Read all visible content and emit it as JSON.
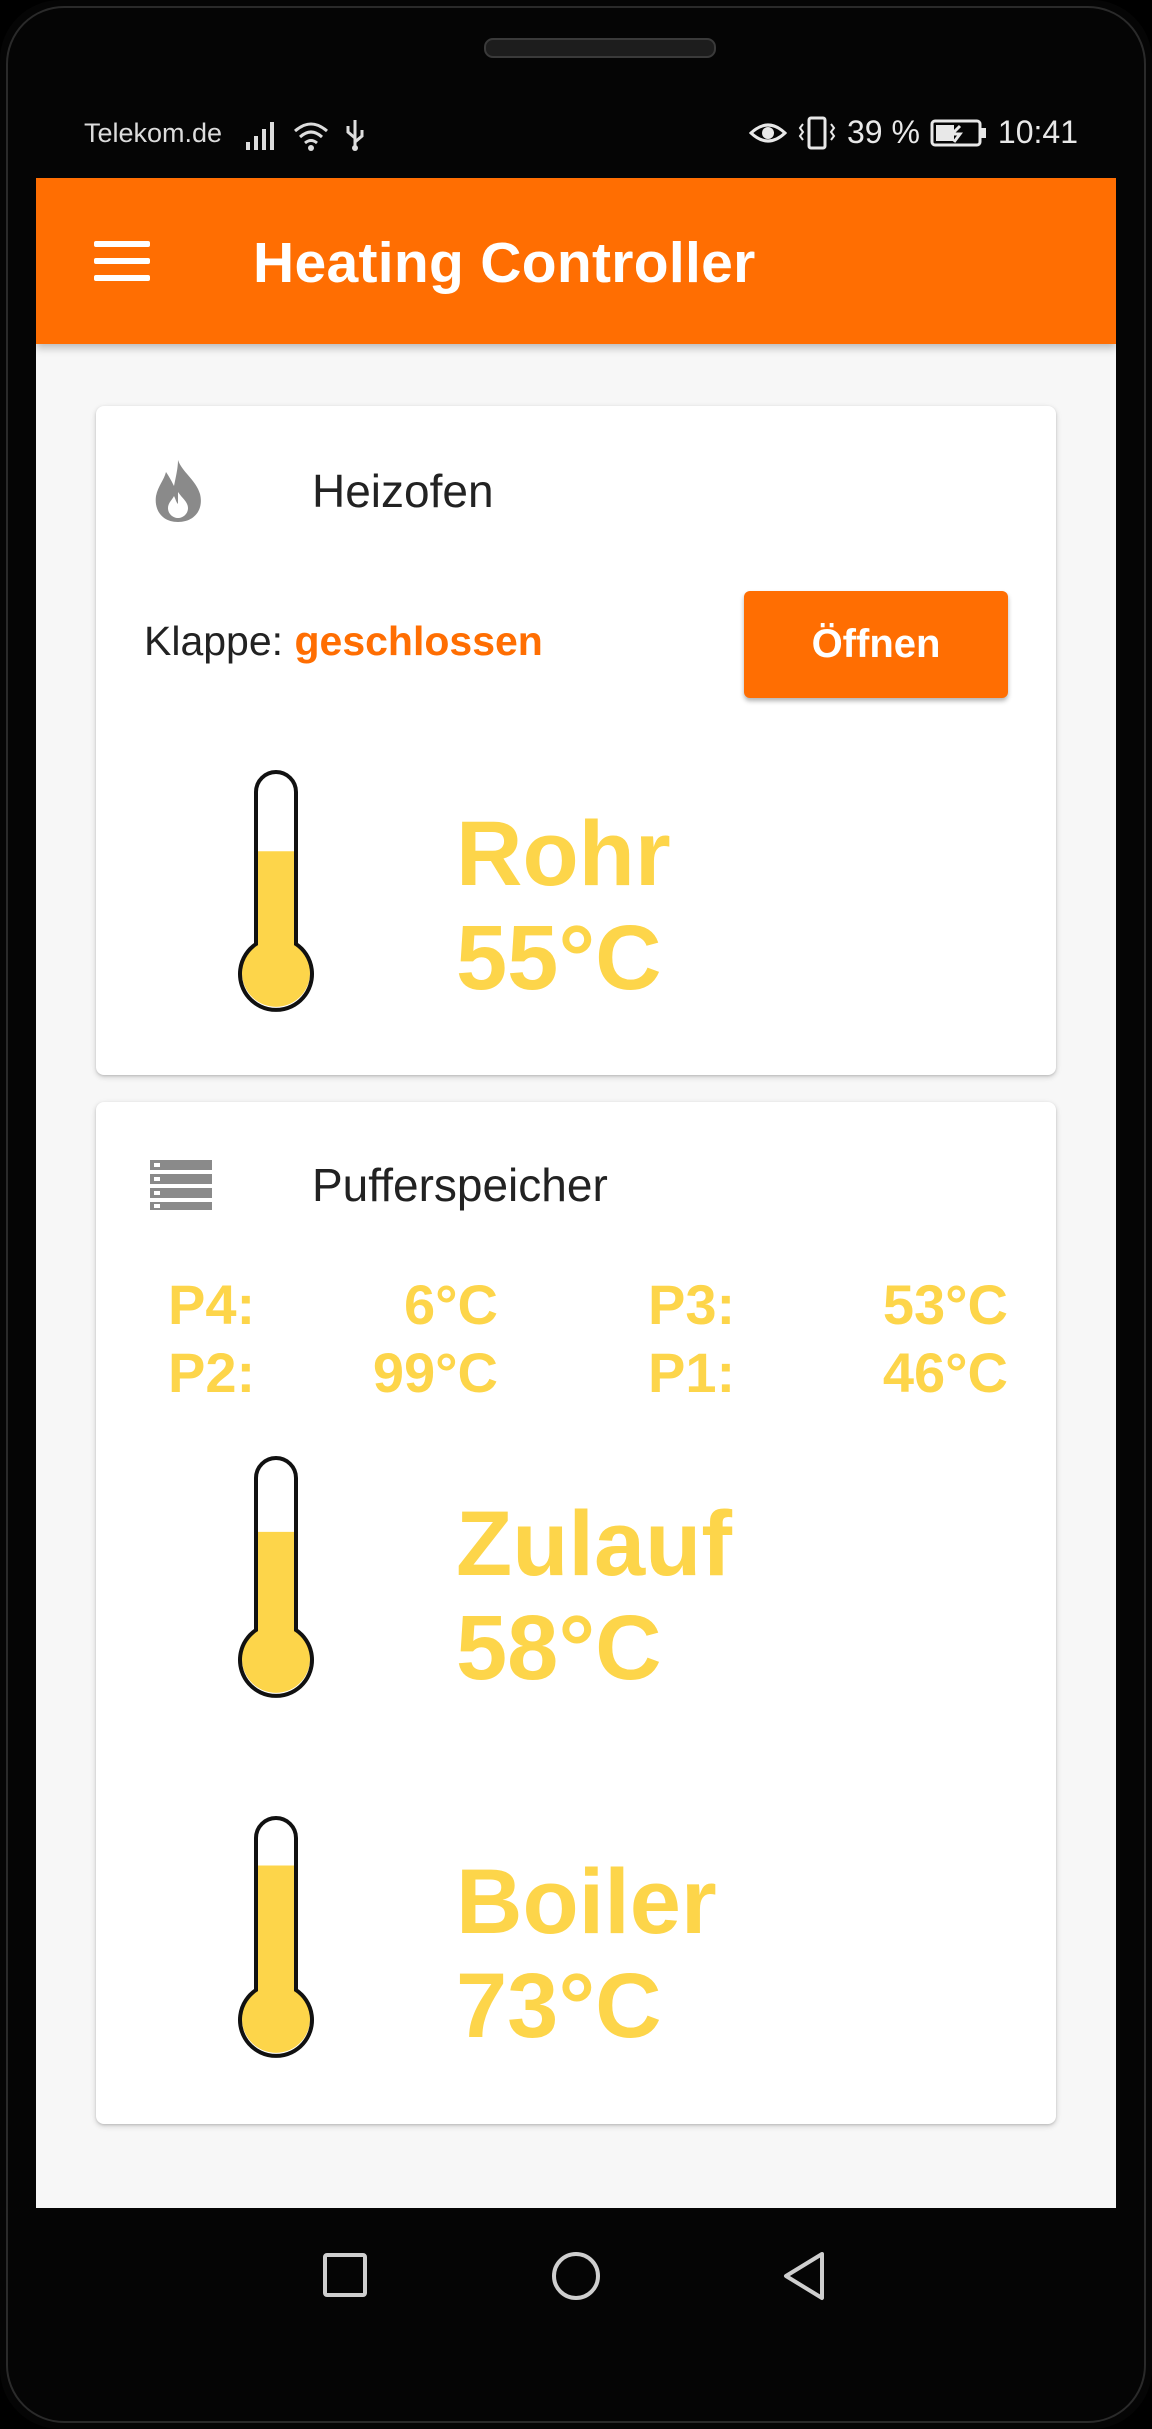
{
  "status_bar": {
    "carrier": "Telekom.de",
    "battery": "39 %",
    "time": "10:41"
  },
  "app": {
    "title": "Heating Controller",
    "menu_icon": "menu-icon",
    "accent_color": "#ff6e02",
    "temp_color": "#fdd54a"
  },
  "heizofen": {
    "title": "Heizofen",
    "icon": "flame-icon",
    "klappe_label": "Klappe:",
    "klappe_state": "geschlossen",
    "open_button": "Öffnen",
    "rohr": {
      "label": "Rohr",
      "value": "55°C",
      "fill_percent": 55
    }
  },
  "pufferspeicher": {
    "title": "Pufferspeicher",
    "icon": "storage-layers-icon",
    "sensors": [
      {
        "label": "P4:",
        "value": "6°C"
      },
      {
        "label": "P3:",
        "value": "53°C"
      },
      {
        "label": "P2:",
        "value": "99°C"
      },
      {
        "label": "P1:",
        "value": "46°C"
      }
    ],
    "zulauf": {
      "label": "Zulauf",
      "value": "58°C",
      "fill_percent": 58
    },
    "boiler": {
      "label": "Boiler",
      "value": "73°C",
      "fill_percent": 73
    }
  },
  "navigation": {
    "icons": [
      "recent-apps-icon",
      "home-icon",
      "back-icon"
    ]
  }
}
